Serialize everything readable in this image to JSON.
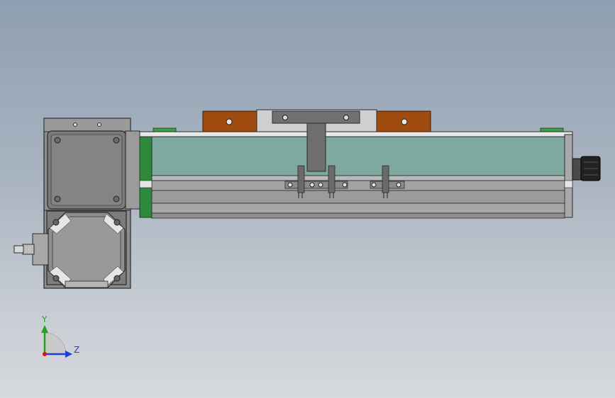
{
  "viewport": {
    "background_top": "#8e9fb1",
    "background_bottom": "#d6d9dd"
  },
  "model": {
    "name": "",
    "parts": [
      "gear-motor",
      "gearbox-housing",
      "linear-module-body",
      "carriage-plate",
      "sensor-brackets",
      "cable-connector"
    ],
    "colors": {
      "body_teal": "#7fa8a1",
      "carriage_orange": "#a04c10",
      "end_green": "#2e8a3a",
      "metal_gray": "#8e8e8e",
      "dark_edge": "#2b2b2b"
    }
  },
  "triad": {
    "y_label": "Y",
    "z_label": "Z",
    "y_color": "#1fa31f",
    "z_color": "#1f3fd9",
    "origin_color": "#d11"
  }
}
